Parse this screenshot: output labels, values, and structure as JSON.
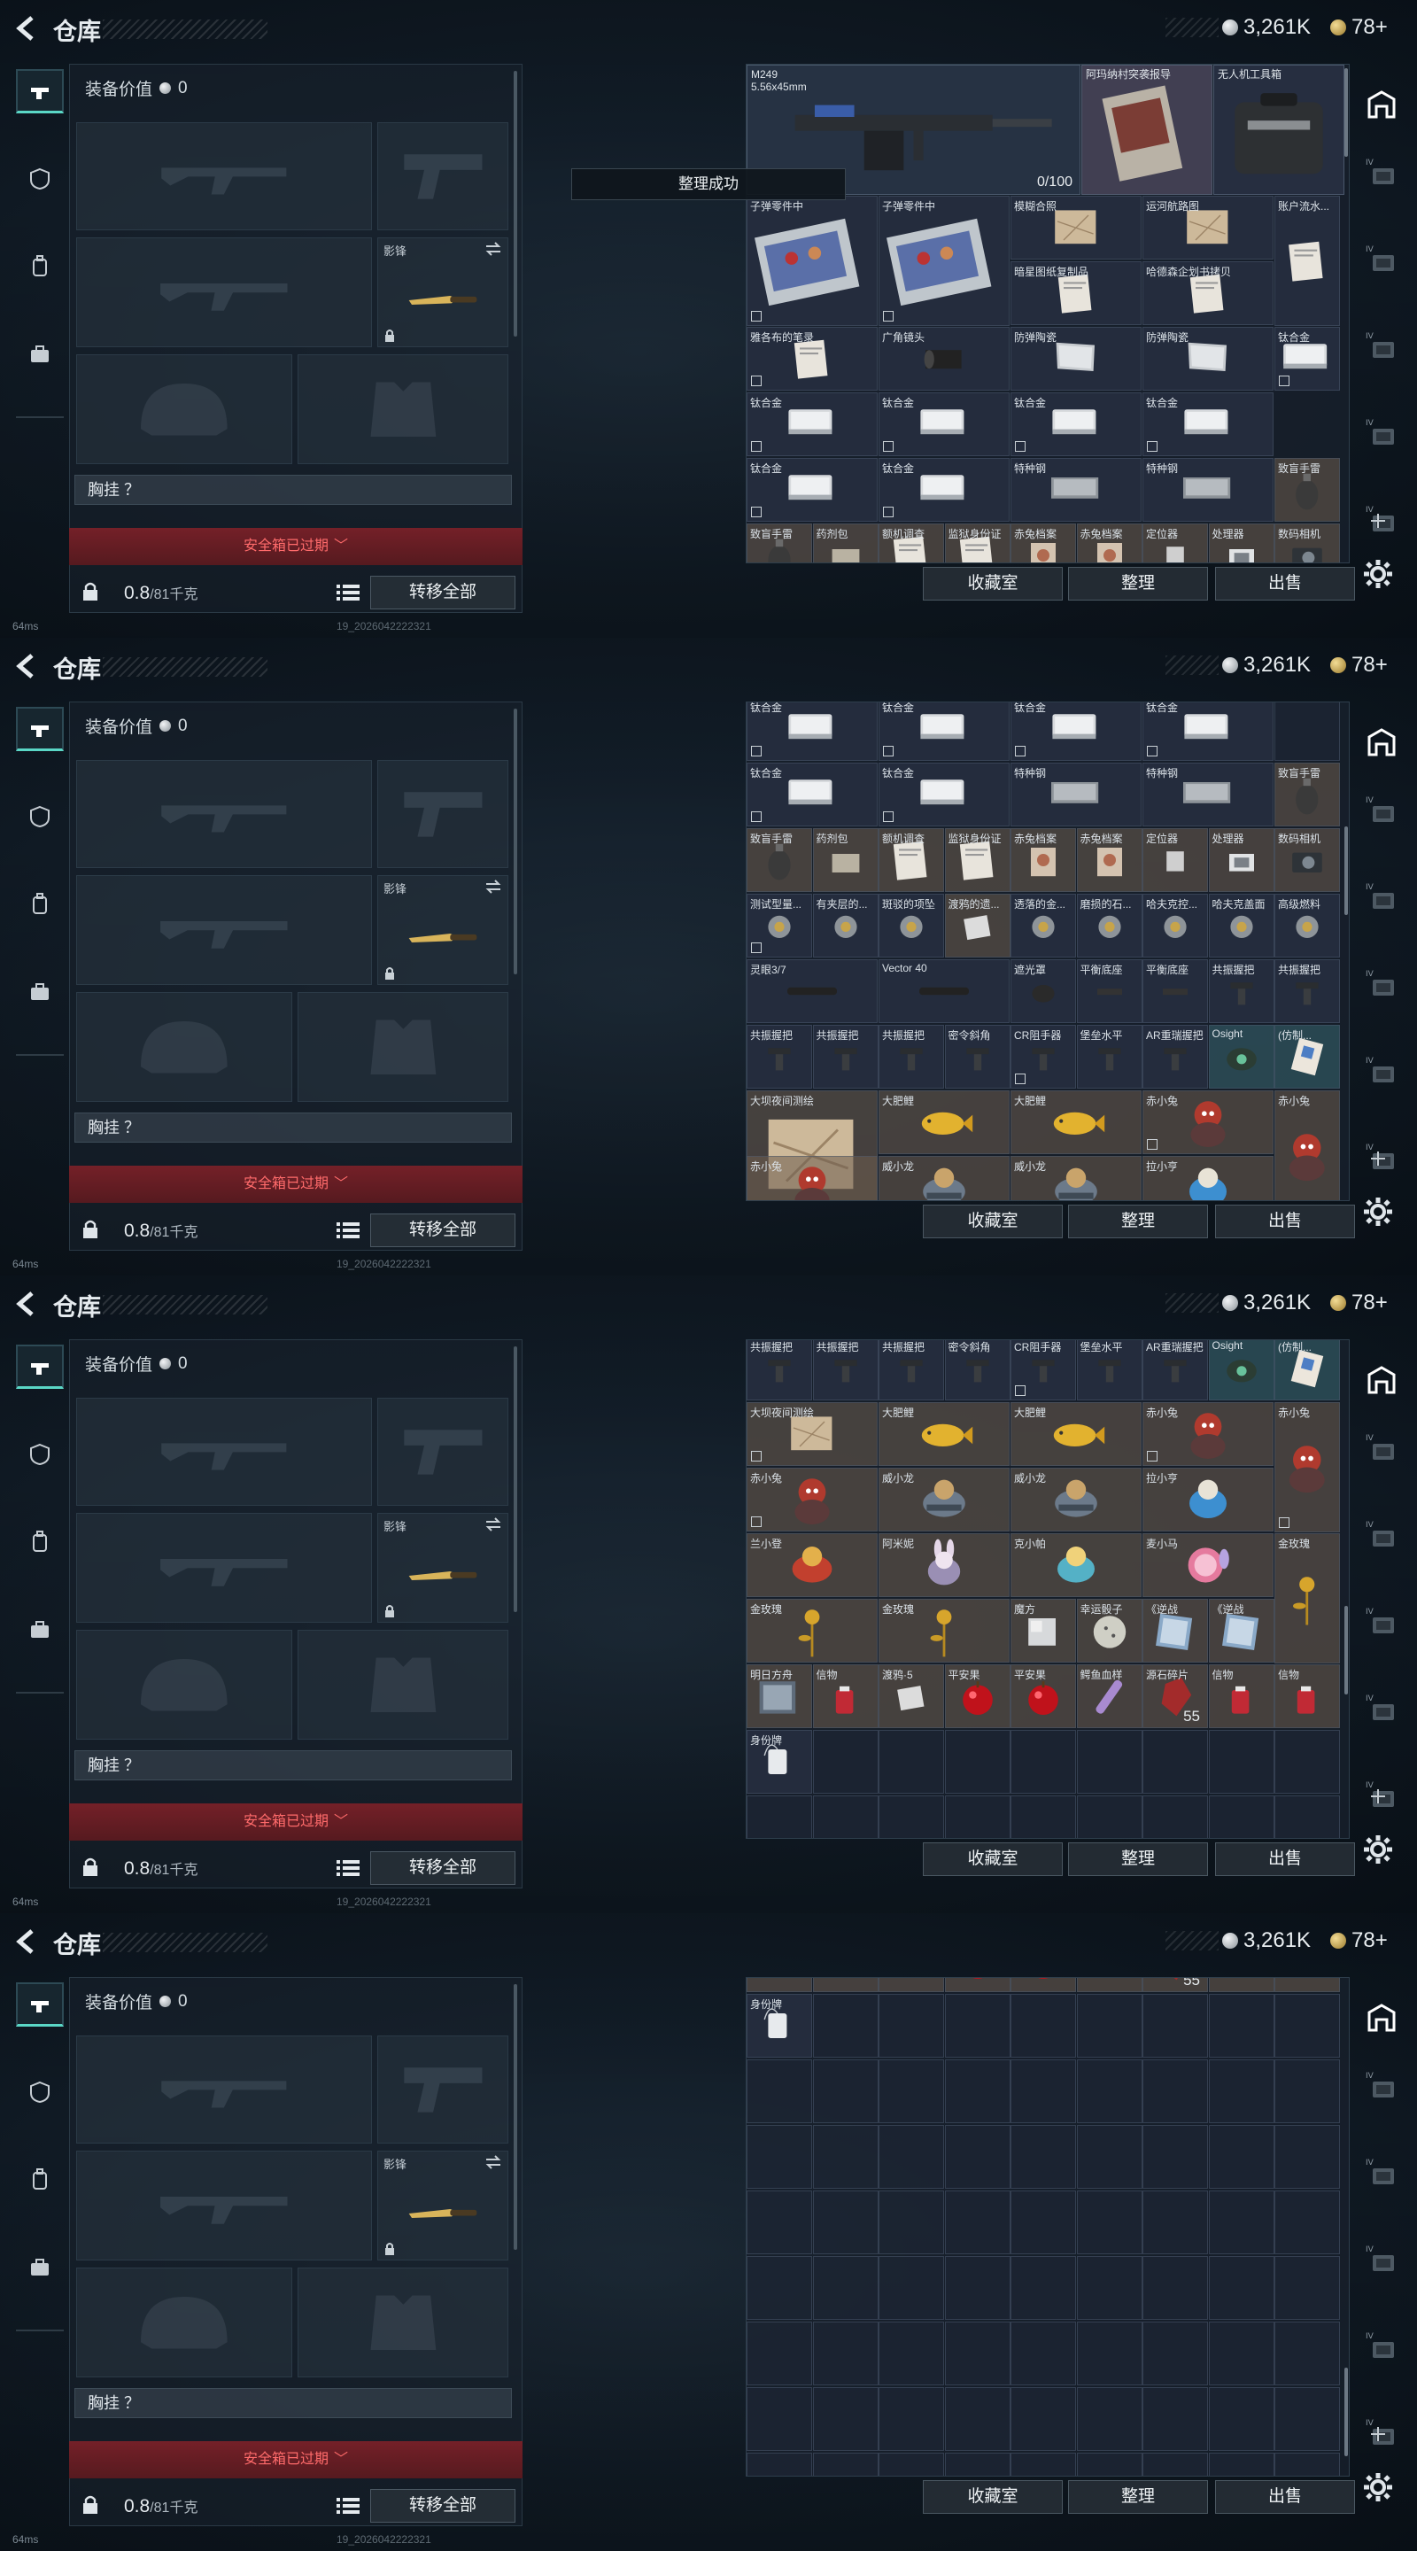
{
  "header": {
    "title": "仓库",
    "silver": "3,261K",
    "gold": "78+"
  },
  "nav": {
    "left": [
      "weapon-icon",
      "armor-icon",
      "backpack-icon",
      "case-icon"
    ]
  },
  "equipment": {
    "value_label": "装备价值",
    "value": "0",
    "melee_label": "影锋",
    "vest_label": "胸挂 ？",
    "safe_box": "安全箱已过期",
    "weight_current": "0.8",
    "weight_max": "/81千克",
    "transfer_all": "转移全部"
  },
  "status": {
    "ping": "64ms",
    "build": "19_2026042222321"
  },
  "toast": "整理成功",
  "storage": {
    "buttons": {
      "collection": "收藏室",
      "arrange": "整理",
      "sell": "出售"
    },
    "weapon": {
      "name": "M249",
      "caliber": "5.56x45mm",
      "capacity": "0/100"
    },
    "poster": "阿玛纳村突袭报导",
    "drone_case": "无人机工具箱",
    "section1": [
      [
        "子弹零件中",
        "子弹零件中",
        "模糊合照",
        "运河航路图",
        "账户流水..."
      ],
      [
        "",
        "",
        "暗星图纸复制品",
        "哈德森企划书拷贝",
        ""
      ],
      [
        "雅各布的笔录",
        "广角镜头",
        "防弹陶瓷",
        "防弹陶瓷",
        "钛合金"
      ],
      [
        "钛合金",
        "钛合金",
        "钛合金",
        "钛合金",
        ""
      ],
      [
        "钛合金",
        "钛合金",
        "特种钢",
        "特种钢",
        "致盲手雷"
      ],
      [
        "致盲手雷",
        "药剂包",
        "额机调查",
        "监狱身份证",
        "赤兔档案",
        "赤兔档案",
        "定位器",
        "处理器",
        "数码相机"
      ]
    ],
    "section2": [
      [
        "钛合金",
        "钛合金",
        "钛合金",
        "钛合金",
        ""
      ],
      [
        "钛合金",
        "钛合金",
        "特种钢",
        "特种钢",
        "致盲手雷"
      ],
      [
        "致盲手雷",
        "药剂包",
        "额机调查",
        "监狱身份证",
        "赤兔档案",
        "赤兔档案",
        "定位器",
        "处理器",
        "数码相机"
      ],
      [
        "测试型量...",
        "有夹层的...",
        "斑驳的项坠",
        "渡鸦的遗...",
        "透落的金...",
        "磨损的石...",
        "哈夫克控...",
        "哈夫克盖面",
        "高级燃料"
      ],
      [
        "灵眼3/7",
        "Vector 40",
        "遮光罩",
        "平衡底座",
        "平衡底座",
        "共振握把",
        "共振握把"
      ],
      [
        "共振握把",
        "共振握把",
        "共振握把",
        "密令斜角",
        "CR阻手器",
        "堡垒水平",
        "AR重瑞握把",
        "Osight",
        "(仿制..."
      ],
      [
        "大坝夜间测绘",
        "大肥鲤",
        "大肥鲤",
        "赤小兔",
        "赤小兔"
      ],
      [
        "赤小兔",
        "威小龙",
        "威小龙",
        "拉小亨"
      ]
    ],
    "section3": [
      [
        "共振握把",
        "共振握把",
        "共振握把",
        "密令斜角",
        "CR阻手器",
        "堡垒水平",
        "AR重瑞握把",
        "Osight",
        "(仿制..."
      ],
      [
        "大坝夜间测绘",
        "大肥鲤",
        "大肥鲤",
        "赤小兔",
        "赤小兔"
      ],
      [
        "赤小兔",
        "威小龙",
        "威小龙",
        "拉小亨"
      ],
      [
        "兰小登",
        "阿米妮",
        "克小帕",
        "麦小马",
        "金玫瑰"
      ],
      [
        "金玫瑰",
        "金玫瑰",
        "魔方",
        "幸运骰子",
        "《逆战",
        "《逆战",
        ""
      ],
      [
        "明日方舟",
        "信物",
        "渡鸦·5",
        "平安果",
        "平安果",
        "鳄鱼血样",
        "源石碎片",
        "信物",
        "信物"
      ],
      [
        "身份牌"
      ]
    ],
    "stack_qty": "55",
    "id_tag": "身份牌"
  }
}
